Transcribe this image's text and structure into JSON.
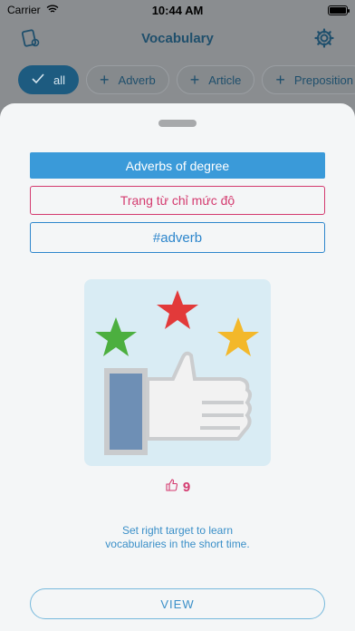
{
  "status": {
    "carrier": "Carrier",
    "time": "10:44 AM"
  },
  "nav": {
    "title": "Vocabulary",
    "left_icon": "cards-settings-icon",
    "right_icon": "gear-icon"
  },
  "chips": [
    {
      "label": "all",
      "active": true
    },
    {
      "label": "Adverb",
      "active": false
    },
    {
      "label": "Article",
      "active": false
    },
    {
      "label": "Preposition",
      "active": false
    }
  ],
  "card": {
    "title": "Adverbs of degree",
    "meaning": "Trạng từ chỉ mức độ",
    "tag": "#adverb",
    "likes": "9",
    "hint_line1": "Set right target to learn",
    "hint_line2": "vocabularies in the short time.",
    "view_label": "VIEW"
  },
  "colors": {
    "accent": "#3a9ad9",
    "meaning": "#d43a6f",
    "tag": "#2d86cc"
  }
}
